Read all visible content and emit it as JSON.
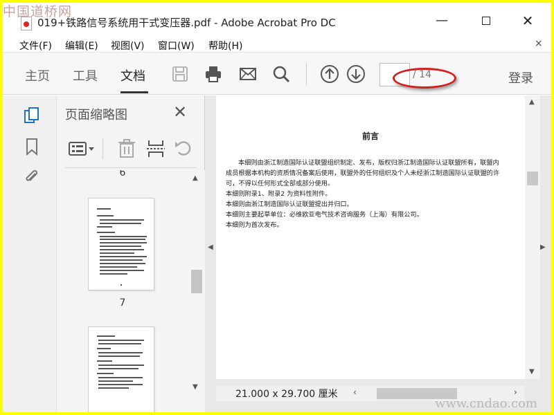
{
  "watermark": {
    "top": "中国道桥网",
    "bottom": "www.cndao.com"
  },
  "window": {
    "title": "019+铁路信号系统用干式变压器.pdf - Adobe Acrobat Pro DC",
    "minimize": "—",
    "close": "✕"
  },
  "menu": {
    "items": [
      "文件(F)",
      "编辑(E)",
      "视图(V)",
      "窗口(W)",
      "帮助(H)"
    ],
    "close": "×"
  },
  "toolbar": {
    "tabs": [
      "主页",
      "工具",
      "文档"
    ],
    "active_tab": "文档",
    "icons": [
      "save-icon",
      "print-icon",
      "email-icon",
      "search-icon",
      "page-up-icon",
      "page-down-icon"
    ],
    "page_input": "",
    "page_total": "/ 14",
    "login": "登录"
  },
  "left_rail": {
    "icons": [
      "thumbnails-icon",
      "bookmark-icon",
      "attachment-icon"
    ]
  },
  "thumbnails": {
    "title": "页面缩略图",
    "close": "✕",
    "tools": [
      "options-icon",
      "trash-icon",
      "insert-page-icon",
      "rotate-icon"
    ],
    "prev_label": "6",
    "page_label": "7"
  },
  "document": {
    "heading": "前言",
    "paragraphs": [
      "本细则由浙江制造国际认证联盟组织制定、发布，版权归浙江制造国际认证联盟所有，联盟内",
      "成员根据本机构的资质情况备案后使用，联盟外的任何组织及个人未经浙江制造国际认证联盟的许",
      "可，不得以任何形式全部或部分使用。",
      "本细则附录1、附录2 为资料性附件。",
      "本细则由浙江制造国际认证联盟提出并归口。",
      "本细则主要起草单位：必维欧亚电气技术咨询服务（上海）有限公司。",
      "本细则为首次发布。"
    ],
    "page_size": "21.000 x 29.700 厘米"
  },
  "colors": {
    "frame": "#ffff00",
    "annotation": "#d21f1f"
  }
}
